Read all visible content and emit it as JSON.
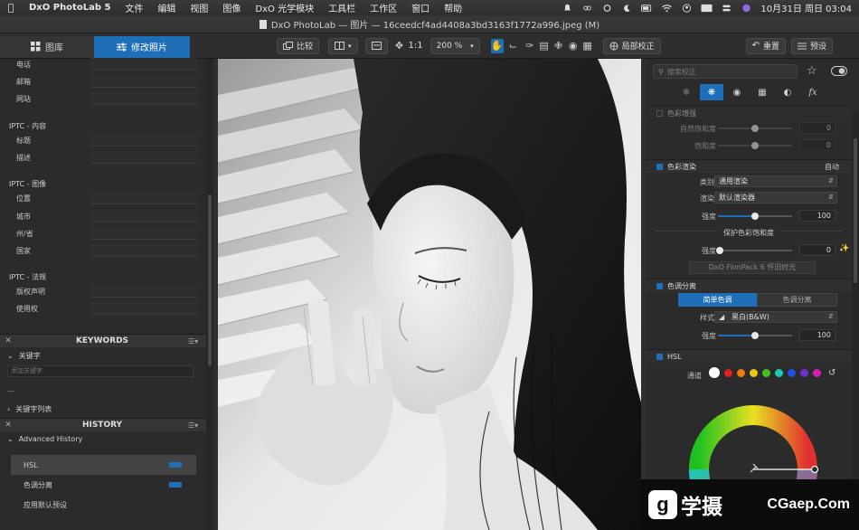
{
  "menubar": {
    "app_name": "DxO PhotoLab 5",
    "items": [
      "文件",
      "编辑",
      "视图",
      "图像",
      "DxO 光学模块",
      "工具栏",
      "工作区",
      "窗口",
      "帮助"
    ],
    "clock": "10月31日 周日 03:04"
  },
  "window": {
    "title": "DxO PhotoLab — 图片 — 16ceedcf4ad4408a3bd3163f1772a996.jpeg (M)"
  },
  "toolbar": {
    "library_tab": "图库",
    "customize_tab": "修改照片",
    "compare_label": "比较",
    "ratio_label": "1:1",
    "zoom_label": "200 %",
    "local_adjust_label": "局部校正",
    "reset_label": "重置",
    "preset_label": "预设"
  },
  "left": {
    "contact_fields": [
      "电话",
      "邮箱",
      "网站"
    ],
    "iptc_content_title": "IPTC - 内容",
    "iptc_content_fields": [
      "标题",
      "描述"
    ],
    "iptc_image_title": "IPTC - 图像",
    "iptc_image_fields": [
      "位置",
      "城市",
      "州/省",
      "国家"
    ],
    "iptc_legal_title": "IPTC - 法规",
    "iptc_legal_fields": [
      "版权声明",
      "使用权"
    ],
    "keywords_header": "KEYWORDS",
    "keywords_label": "关键字",
    "keywords_placeholder": "添加关键字",
    "keywords_separator": "—",
    "keyword_list_label": "关键字列表",
    "history_header": "HISTORY",
    "advanced_history": "Advanced History",
    "history_items": [
      "HSL",
      "色调分离",
      "应用默认预设"
    ]
  },
  "right": {
    "search_placeholder": "搜索校正",
    "color_boost": {
      "title": "色彩增强",
      "vibrancy_label": "自然饱和度",
      "vibrancy_value": "0",
      "saturation_label": "饱和度",
      "saturation_value": "0"
    },
    "color_rendering": {
      "title": "色彩渲染",
      "auto_label": "自动",
      "category_label": "类别",
      "category_value": "通用渲染",
      "rendering_label": "渲染",
      "rendering_value": "默认渲染器",
      "intensity_label": "强度",
      "intensity_value": "100",
      "intensity_level": 0.5,
      "protect_title": "保护色彩饱和度",
      "protect_intensity_label": "强度",
      "protect_intensity_value": "0",
      "filmpack_button": "DxO FilmPack 6 怀旧时光"
    },
    "split_toning": {
      "title": "色调分离",
      "simple_tab": "简单色调",
      "split_tab": "色调分离",
      "style_label": "样式",
      "style_value": "黑白(B&W)",
      "intensity_label": "强度",
      "intensity_value": "100",
      "intensity_level": 0.5
    },
    "hsl": {
      "title": "HSL",
      "channel_label": "通道",
      "channel_colors": [
        "#ffffff",
        "#e02020",
        "#f07a10",
        "#e8c810",
        "#40c020",
        "#20c8b0",
        "#2050e0",
        "#7030d0",
        "#d020b0"
      ]
    }
  },
  "watermark": {
    "logo_letter": "g",
    "cn_text": "学摄",
    "url": "CGaep.Com"
  },
  "colors": {
    "accent": "#1e6fb8",
    "panel_bg": "#2b2b2b"
  }
}
